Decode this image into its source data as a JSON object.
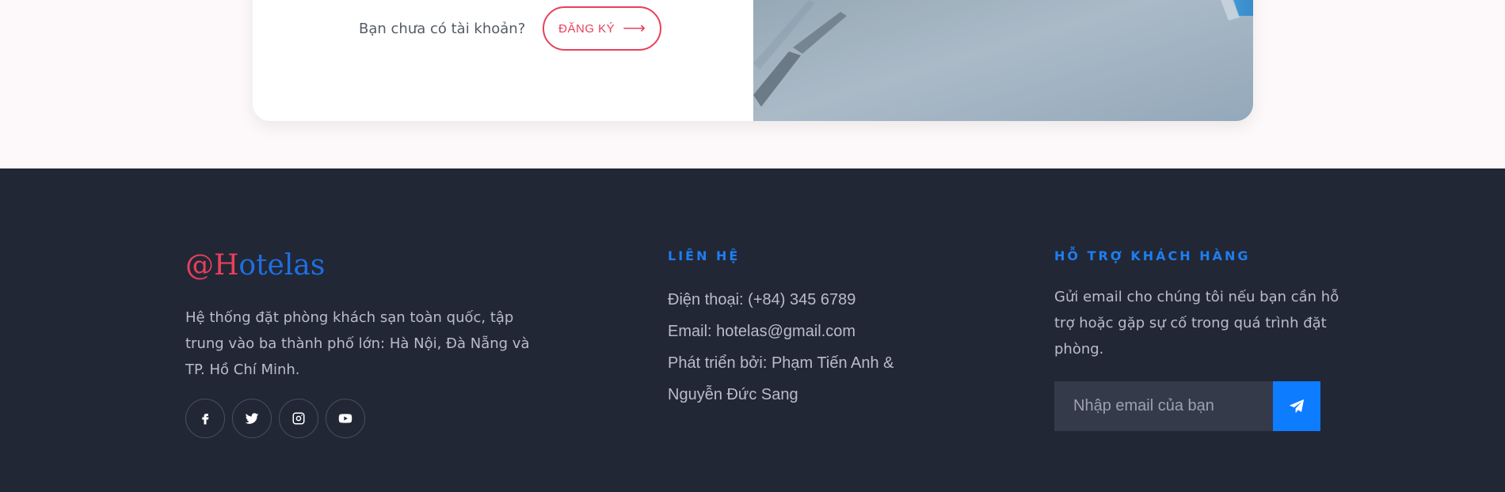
{
  "signup": {
    "prompt": "Bạn chưa có tài khoản?",
    "button_label": "ĐĂNG KÝ",
    "button_arrow": "⟶"
  },
  "footer": {
    "brand": {
      "at_h": "@H",
      "rest": "otelas"
    },
    "about": "Hệ thống đặt phòng khách sạn toàn quốc, tập trung vào ba thành phố lớn: Hà Nội, Đà Nẵng và TP. Hồ Chí Minh.",
    "socials": [
      {
        "icon": "facebook-icon"
      },
      {
        "icon": "twitter-icon"
      },
      {
        "icon": "instagram-icon"
      },
      {
        "icon": "youtube-icon"
      }
    ],
    "contact": {
      "title": "LIÊN HỆ",
      "phone": "Điện thoại: (+84) 345 6789",
      "email": "Email: hotelas@gmail.com",
      "developers_line1": "Phát triển bởi: Phạm Tiến Anh &",
      "developers_line2": "Nguyễn Đức Sang"
    },
    "support": {
      "title": "HỖ TRỢ KHÁCH HÀNG",
      "text": "Gửi email cho chúng tôi nếu bạn cần hỗ trợ hoặc gặp sự cố trong quá trình đặt phòng.",
      "email_placeholder": "Nhập email của bạn",
      "send_icon": "paper-plane-icon"
    }
  },
  "colors": {
    "accent_red": "#e8405c",
    "accent_blue": "#1e7ef0",
    "footer_bg": "#222736",
    "send_button": "#0d7cff"
  }
}
